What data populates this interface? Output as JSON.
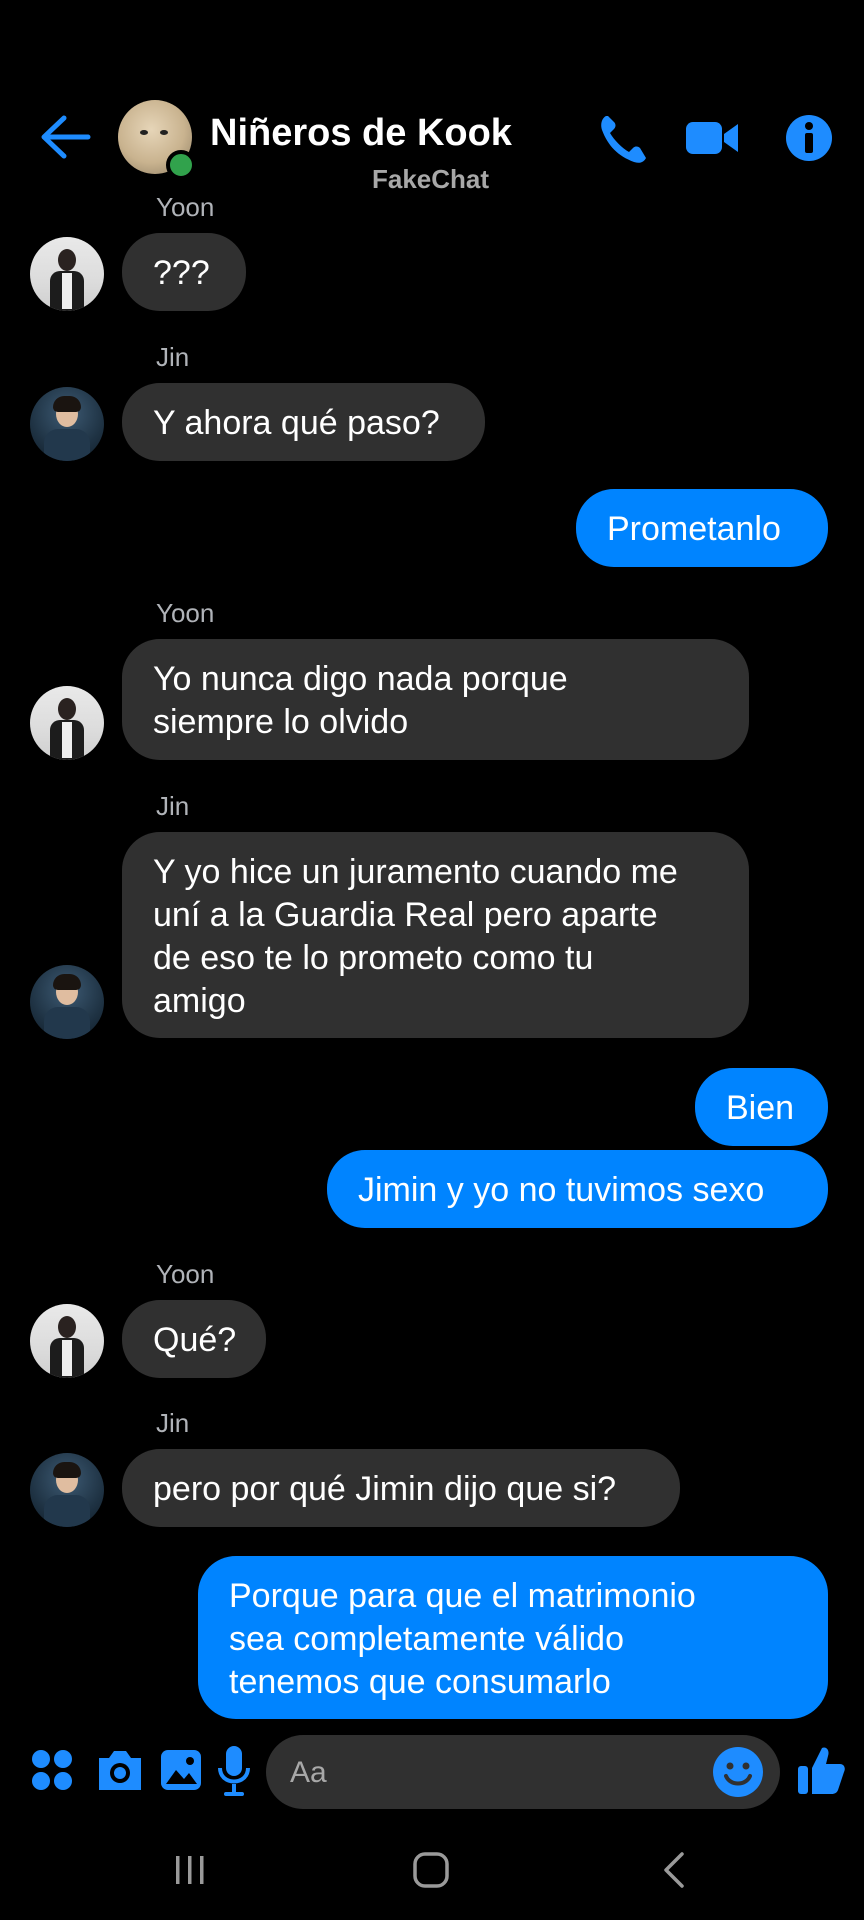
{
  "header": {
    "title": "Niñeros de Kook",
    "subtitle": "FakeChat",
    "icons": [
      "back-arrow-icon",
      "phone-icon",
      "video-camera-icon",
      "info-icon"
    ]
  },
  "messages": [
    {
      "sender": "Yoon",
      "direction": "in",
      "lines": [
        "???"
      ]
    },
    {
      "sender": "Jin",
      "direction": "in",
      "lines": [
        "Y ahora qué paso?"
      ]
    },
    {
      "sender": "",
      "direction": "out",
      "lines": [
        "Prometanlo"
      ]
    },
    {
      "sender": "Yoon",
      "direction": "in",
      "lines": [
        "Yo nunca digo nada porque",
        "siempre lo olvido"
      ]
    },
    {
      "sender": "Jin",
      "direction": "in",
      "lines": [
        "Y yo hice un juramento cuando me",
        "uní a la Guardia Real pero aparte",
        "de eso te lo prometo como tu",
        "amigo"
      ]
    },
    {
      "sender": "",
      "direction": "out",
      "lines": [
        "Bien"
      ]
    },
    {
      "sender": "",
      "direction": "out",
      "lines": [
        "Jimin y yo no tuvimos sexo"
      ]
    },
    {
      "sender": "Yoon",
      "direction": "in",
      "lines": [
        "Qué?"
      ]
    },
    {
      "sender": "Jin",
      "direction": "in",
      "lines": [
        "pero por qué Jimin dijo que si?"
      ]
    },
    {
      "sender": "",
      "direction": "out",
      "lines": [
        "Porque para que el matrimonio",
        "sea completamente válido",
        "tenemos que consumarlo"
      ]
    }
  ],
  "composer": {
    "placeholder": "Aa",
    "icons": [
      "apps-grid-icon",
      "camera-icon",
      "image-icon",
      "microphone-icon",
      "emoji-icon",
      "thumbs-up-icon"
    ]
  },
  "colors": {
    "accent": "#0084ff",
    "incoming_bubble": "#303030",
    "background": "#000000",
    "online": "#31a24c"
  }
}
